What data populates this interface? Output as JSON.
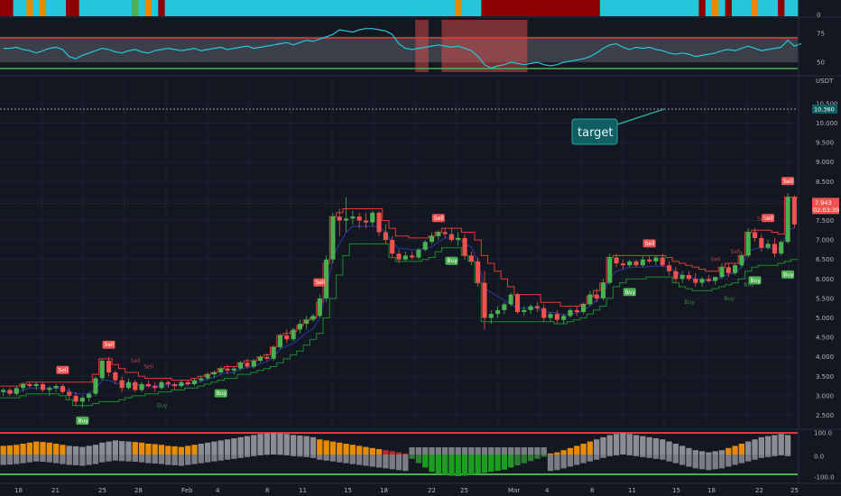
{
  "chart_data": {
    "type": "candlestick",
    "symbol_unit": "USDT",
    "colors": {
      "background": "#131722",
      "up": "#26a69a",
      "up_bright": "#4caf50",
      "down": "#ef5350",
      "cyan": "#26c6da",
      "dark_red": "#8b0000",
      "orange": "#e68a00",
      "band_fill": "#5d606b",
      "trail_red": "#e53935",
      "trail_green": "#1b8a2f",
      "ma_blue": "#283593"
    },
    "x_axis": {
      "labels": [
        "18",
        "21",
        "25",
        "28",
        "Feb",
        "4",
        "8",
        "11",
        "15",
        "18",
        "22",
        "25",
        "Mar",
        "4",
        "8",
        "11",
        "15",
        "18",
        "22",
        "25"
      ]
    },
    "price_axis": {
      "ticks": [
        "10.500",
        "10.000",
        "9.500",
        "9.000",
        "8.500",
        "8.000",
        "7.500",
        "7.000",
        "6.500",
        "6.000",
        "5.500",
        "5.000",
        "4.500",
        "4.000",
        "3.500",
        "3.000",
        "2.500"
      ],
      "target_level_label": "10.360",
      "last_price_label": "7.943",
      "countdown_label": "02:03:39"
    },
    "callout": {
      "text": "target"
    },
    "signal_labels": {
      "buy": "Buy",
      "sell": "Sell"
    },
    "candles": [
      [
        3.1,
        3.2,
        3.0,
        3.15
      ],
      [
        3.15,
        3.2,
        3.0,
        3.05
      ],
      [
        3.05,
        3.25,
        3.0,
        3.2
      ],
      [
        3.2,
        3.35,
        3.1,
        3.3
      ],
      [
        3.3,
        3.35,
        3.2,
        3.25
      ],
      [
        3.25,
        3.35,
        3.15,
        3.3
      ],
      [
        3.3,
        3.35,
        3.1,
        3.15
      ],
      [
        3.15,
        3.25,
        3.0,
        3.2
      ],
      [
        3.2,
        3.3,
        3.1,
        3.25
      ],
      [
        3.25,
        3.3,
        3.05,
        3.1
      ],
      [
        3.1,
        3.2,
        2.9,
        3.0
      ],
      [
        3.0,
        3.1,
        2.75,
        2.85
      ],
      [
        2.85,
        3.0,
        2.7,
        2.95
      ],
      [
        2.95,
        3.1,
        2.85,
        3.05
      ],
      [
        3.05,
        3.5,
        3.0,
        3.45
      ],
      [
        3.45,
        3.95,
        3.4,
        3.9
      ],
      [
        3.9,
        4.0,
        3.5,
        3.6
      ],
      [
        3.6,
        3.65,
        3.3,
        3.4
      ],
      [
        3.4,
        3.5,
        3.1,
        3.2
      ],
      [
        3.2,
        3.45,
        3.15,
        3.35
      ],
      [
        3.35,
        3.4,
        3.1,
        3.15
      ],
      [
        3.15,
        3.35,
        3.1,
        3.3
      ],
      [
        3.3,
        3.4,
        3.2,
        3.25
      ],
      [
        3.25,
        3.35,
        3.1,
        3.2
      ],
      [
        3.2,
        3.4,
        3.15,
        3.35
      ],
      [
        3.35,
        3.4,
        3.2,
        3.3
      ],
      [
        3.3,
        3.35,
        3.15,
        3.25
      ],
      [
        3.25,
        3.4,
        3.2,
        3.35
      ],
      [
        3.35,
        3.4,
        3.25,
        3.3
      ],
      [
        3.3,
        3.45,
        3.25,
        3.4
      ],
      [
        3.4,
        3.5,
        3.35,
        3.45
      ],
      [
        3.45,
        3.6,
        3.4,
        3.55
      ],
      [
        3.55,
        3.65,
        3.45,
        3.6
      ],
      [
        3.6,
        3.75,
        3.55,
        3.7
      ],
      [
        3.7,
        3.8,
        3.55,
        3.65
      ],
      [
        3.65,
        3.75,
        3.55,
        3.7
      ],
      [
        3.7,
        3.9,
        3.65,
        3.85
      ],
      [
        3.85,
        3.95,
        3.7,
        3.75
      ],
      [
        3.75,
        3.95,
        3.7,
        3.9
      ],
      [
        3.9,
        4.05,
        3.85,
        4.0
      ],
      [
        4.0,
        4.1,
        3.9,
        3.95
      ],
      [
        3.95,
        4.3,
        3.9,
        4.25
      ],
      [
        4.25,
        4.6,
        4.2,
        4.55
      ],
      [
        4.55,
        4.7,
        4.35,
        4.45
      ],
      [
        4.45,
        4.75,
        4.4,
        4.7
      ],
      [
        4.7,
        4.95,
        4.6,
        4.85
      ],
      [
        4.85,
        5.05,
        4.7,
        4.95
      ],
      [
        4.95,
        5.1,
        4.9,
        5.05
      ],
      [
        5.05,
        5.6,
        5.0,
        5.5
      ],
      [
        5.5,
        6.6,
        5.4,
        6.5
      ],
      [
        6.5,
        7.7,
        6.4,
        7.6
      ],
      [
        7.6,
        7.8,
        7.1,
        7.5
      ],
      [
        7.5,
        8.1,
        7.2,
        7.55
      ],
      [
        7.55,
        7.75,
        7.4,
        7.6
      ],
      [
        7.6,
        7.7,
        7.3,
        7.5
      ],
      [
        7.5,
        7.7,
        7.3,
        7.45
      ],
      [
        7.45,
        7.75,
        7.35,
        7.7
      ],
      [
        7.7,
        7.75,
        7.1,
        7.2
      ],
      [
        7.2,
        7.4,
        6.9,
        7.0
      ],
      [
        7.0,
        7.1,
        6.55,
        6.65
      ],
      [
        6.65,
        6.75,
        6.4,
        6.5
      ],
      [
        6.5,
        6.7,
        6.45,
        6.6
      ],
      [
        6.6,
        6.7,
        6.5,
        6.55
      ],
      [
        6.55,
        6.8,
        6.5,
        6.75
      ],
      [
        6.75,
        7.0,
        6.7,
        6.95
      ],
      [
        6.95,
        7.2,
        6.9,
        7.1
      ],
      [
        7.1,
        7.25,
        7.0,
        7.2
      ],
      [
        7.2,
        7.3,
        7.05,
        7.15
      ],
      [
        7.15,
        7.3,
        6.95,
        7.0
      ],
      [
        7.0,
        7.2,
        6.85,
        7.05
      ],
      [
        7.05,
        7.15,
        6.5,
        6.6
      ],
      [
        6.6,
        6.7,
        6.35,
        6.45
      ],
      [
        6.45,
        6.55,
        5.8,
        5.9
      ],
      [
        5.9,
        6.2,
        4.7,
        5.0
      ],
      [
        5.0,
        5.2,
        4.85,
        5.1
      ],
      [
        5.1,
        5.3,
        5.0,
        5.2
      ],
      [
        5.2,
        5.4,
        5.1,
        5.35
      ],
      [
        5.35,
        5.65,
        5.3,
        5.6
      ],
      [
        5.6,
        5.65,
        5.1,
        5.15
      ],
      [
        5.15,
        5.3,
        5.05,
        5.2
      ],
      [
        5.2,
        5.35,
        5.1,
        5.3
      ],
      [
        5.3,
        5.4,
        5.15,
        5.25
      ],
      [
        5.25,
        5.35,
        4.9,
        5.0
      ],
      [
        5.0,
        5.15,
        4.9,
        5.1
      ],
      [
        5.1,
        5.2,
        4.85,
        4.95
      ],
      [
        4.95,
        5.1,
        4.85,
        5.05
      ],
      [
        5.05,
        5.25,
        5.0,
        5.2
      ],
      [
        5.2,
        5.3,
        5.05,
        5.15
      ],
      [
        5.15,
        5.4,
        5.1,
        5.35
      ],
      [
        5.35,
        5.7,
        5.3,
        5.6
      ],
      [
        5.6,
        5.75,
        5.4,
        5.5
      ],
      [
        5.5,
        6.0,
        5.45,
        5.9
      ],
      [
        5.9,
        6.65,
        5.85,
        6.55
      ],
      [
        6.55,
        6.65,
        6.3,
        6.4
      ],
      [
        6.4,
        6.5,
        6.25,
        6.35
      ],
      [
        6.35,
        6.5,
        6.3,
        6.45
      ],
      [
        6.45,
        6.5,
        6.3,
        6.35
      ],
      [
        6.35,
        6.6,
        6.3,
        6.5
      ],
      [
        6.5,
        6.6,
        6.4,
        6.45
      ],
      [
        6.45,
        6.6,
        6.35,
        6.55
      ],
      [
        6.55,
        6.65,
        6.3,
        6.35
      ],
      [
        6.35,
        6.45,
        6.1,
        6.2
      ],
      [
        6.2,
        6.3,
        5.9,
        6.0
      ],
      [
        6.0,
        6.2,
        5.9,
        6.1
      ],
      [
        6.1,
        6.2,
        5.95,
        6.0
      ],
      [
        6.0,
        6.15,
        5.8,
        5.9
      ],
      [
        5.9,
        6.05,
        5.8,
        6.0
      ],
      [
        6.0,
        6.1,
        5.9,
        5.95
      ],
      [
        5.95,
        6.05,
        5.85,
        6.05
      ],
      [
        6.05,
        6.4,
        6.0,
        6.3
      ],
      [
        6.3,
        6.4,
        6.05,
        6.15
      ],
      [
        6.15,
        6.4,
        6.1,
        6.35
      ],
      [
        6.35,
        6.7,
        6.3,
        6.6
      ],
      [
        6.6,
        7.3,
        6.55,
        7.2
      ],
      [
        7.2,
        7.3,
        6.95,
        7.05
      ],
      [
        7.05,
        7.15,
        6.7,
        6.8
      ],
      [
        6.8,
        7.0,
        6.75,
        6.9
      ],
      [
        6.9,
        7.05,
        6.55,
        6.65
      ],
      [
        6.65,
        7.0,
        6.6,
        6.95
      ],
      [
        6.95,
        8.2,
        6.9,
        8.1
      ],
      [
        8.1,
        8.15,
        7.3,
        7.4
      ]
    ],
    "trail_red": [
      3.25,
      3.25,
      3.25,
      3.3,
      3.35,
      3.35,
      3.35,
      3.35,
      3.35,
      3.35,
      3.35,
      3.35,
      3.35,
      3.35,
      3.55,
      3.95,
      3.95,
      3.8,
      3.7,
      3.6,
      3.6,
      3.5,
      3.45,
      3.45,
      3.45,
      3.45,
      3.4,
      3.4,
      3.4,
      3.45,
      3.5,
      3.55,
      3.6,
      3.7,
      3.75,
      3.75,
      3.85,
      3.9,
      3.9,
      4.0,
      4.05,
      4.25,
      4.55,
      4.6,
      4.65,
      4.8,
      4.95,
      5.0,
      5.4,
      6.4,
      7.6,
      7.7,
      7.8,
      7.8,
      7.8,
      7.8,
      7.8,
      7.8,
      7.5,
      7.3,
      7.1,
      7.1,
      7.05,
      7.05,
      7.05,
      7.1,
      7.2,
      7.3,
      7.3,
      7.3,
      7.2,
      7.2,
      7.0,
      6.6,
      6.4,
      6.2,
      6.0,
      5.8,
      5.6,
      5.6,
      5.6,
      5.6,
      5.4,
      5.4,
      5.4,
      5.3,
      5.3,
      5.3,
      5.35,
      5.55,
      5.7,
      5.9,
      6.55,
      6.6,
      6.6,
      6.6,
      6.6,
      6.6,
      6.6,
      6.6,
      6.6,
      6.55,
      6.45,
      6.4,
      6.35,
      6.3,
      6.25,
      6.2,
      6.2,
      6.3,
      6.4,
      6.4,
      6.6,
      7.2,
      7.25,
      7.25,
      7.25,
      7.2,
      7.15,
      8.1,
      8.1
    ],
    "trail_green": [
      2.95,
      2.95,
      2.95,
      3.0,
      3.05,
      3.05,
      3.05,
      3.05,
      3.05,
      3.0,
      2.9,
      2.75,
      2.75,
      2.75,
      2.8,
      2.85,
      2.85,
      2.85,
      2.9,
      2.95,
      3.0,
      3.0,
      3.05,
      3.05,
      3.1,
      3.1,
      3.15,
      3.15,
      3.2,
      3.2,
      3.25,
      3.3,
      3.35,
      3.4,
      3.45,
      3.45,
      3.55,
      3.55,
      3.6,
      3.65,
      3.7,
      3.75,
      3.85,
      3.95,
      4.05,
      4.15,
      4.3,
      4.45,
      4.6,
      5.0,
      5.5,
      6.1,
      6.6,
      6.9,
      6.9,
      6.9,
      6.9,
      6.9,
      6.9,
      6.55,
      6.45,
      6.45,
      6.45,
      6.45,
      6.5,
      6.55,
      6.7,
      6.8,
      6.8,
      6.8,
      6.6,
      6.45,
      5.9,
      4.9,
      4.9,
      4.9,
      4.9,
      4.9,
      4.9,
      4.9,
      4.9,
      4.9,
      4.9,
      4.9,
      4.85,
      4.85,
      4.9,
      4.95,
      5.0,
      5.1,
      5.2,
      5.3,
      5.5,
      5.8,
      5.9,
      6.0,
      6.0,
      6.0,
      6.05,
      6.05,
      6.05,
      6.05,
      5.9,
      5.8,
      5.75,
      5.7,
      5.7,
      5.7,
      5.75,
      5.8,
      5.85,
      5.9,
      6.0,
      6.2,
      6.3,
      6.35,
      6.35,
      6.35,
      6.4,
      6.45,
      6.5
    ],
    "buy_indices": [
      12,
      33,
      68,
      95,
      114,
      119
    ],
    "sell_indices": [
      9,
      16,
      48,
      66,
      98,
      116,
      119
    ],
    "faint_buy_indices": [
      24,
      104,
      110,
      113
    ],
    "faint_sell_indices": [
      20,
      22,
      108,
      111,
      115
    ],
    "heat_colors": [
      "darkred",
      "darkred",
      "cyan",
      "cyan",
      "orange",
      "cyan",
      "orange",
      "cyan",
      "cyan",
      "cyan",
      "darkred",
      "darkred",
      "cyan",
      "cyan",
      "cyan",
      "cyan",
      "cyan",
      "cyan",
      "cyan",
      "cyan",
      "green",
      "cyan",
      "orange",
      "cyan",
      "darkred",
      "cyan",
      "cyan",
      "cyan",
      "cyan",
      "cyan",
      "cyan",
      "cyan",
      "cyan",
      "cyan",
      "cyan",
      "cyan",
      "cyan",
      "cyan",
      "cyan",
      "cyan",
      "cyan",
      "cyan",
      "cyan",
      "cyan",
      "cyan",
      "cyan",
      "cyan",
      "cyan",
      "cyan",
      "cyan",
      "cyan",
      "cyan",
      "cyan",
      "cyan",
      "cyan",
      "cyan",
      "cyan",
      "cyan",
      "cyan",
      "cyan",
      "cyan",
      "cyan",
      "cyan",
      "cyan",
      "cyan",
      "cyan",
      "cyan",
      "cyan",
      "cyan",
      "orange",
      "cyan",
      "cyan",
      "cyan",
      "darkred",
      "darkred",
      "darkred",
      "darkred",
      "darkred",
      "darkred",
      "darkred",
      "darkred",
      "darkred",
      "darkred",
      "darkred",
      "darkred",
      "darkred",
      "darkred",
      "darkred",
      "darkred",
      "darkred",
      "darkred",
      "cyan",
      "cyan",
      "cyan",
      "cyan",
      "cyan",
      "cyan",
      "cyan",
      "cyan",
      "cyan",
      "cyan",
      "cyan",
      "cyan",
      "cyan",
      "cyan",
      "cyan",
      "darkred",
      "cyan",
      "orange",
      "cyan",
      "darkred",
      "cyan",
      "cyan",
      "cyan",
      "orange",
      "cyan",
      "cyan",
      "cyan",
      "darkred",
      "cyan",
      "cyan"
    ],
    "osc_axis": {
      "ticks": [
        "75",
        "50"
      ]
    },
    "osc_line": [
      62,
      62,
      63,
      61,
      60,
      58,
      60,
      62,
      63,
      61,
      55,
      53,
      56,
      58,
      60,
      62,
      61,
      59,
      58,
      60,
      61,
      59,
      58,
      60,
      61,
      62,
      61,
      60,
      61,
      62,
      60,
      61,
      62,
      63,
      61,
      62,
      63,
      64,
      62,
      63,
      64,
      65,
      66,
      67,
      65,
      67,
      69,
      68,
      70,
      72,
      74,
      78,
      77,
      76,
      78,
      79,
      79,
      78,
      77,
      74,
      66,
      62,
      61,
      62,
      63,
      64,
      65,
      64,
      63,
      64,
      62,
      60,
      55,
      48,
      45,
      47,
      48,
      50,
      49,
      48,
      49,
      50,
      48,
      47,
      48,
      50,
      51,
      52,
      53,
      55,
      58,
      62,
      65,
      66,
      63,
      61,
      63,
      62,
      63,
      61,
      60,
      58,
      57,
      58,
      57,
      55,
      56,
      57,
      58,
      60,
      61,
      60,
      62,
      64,
      62,
      60,
      61,
      62,
      63,
      69,
      64,
      66
    ],
    "osc_band": [
      50,
      72
    ],
    "osc_highlights": [
      [
        63,
        64
      ],
      [
        67,
        79
      ]
    ],
    "bottom_axis": {
      "ticks": [
        "100.0",
        "0.0",
        "-100.0"
      ]
    },
    "bottom_bars": [
      40,
      42,
      45,
      50,
      55,
      60,
      58,
      55,
      50,
      45,
      40,
      38,
      35,
      40,
      45,
      55,
      60,
      65,
      62,
      60,
      58,
      55,
      50,
      48,
      45,
      40,
      38,
      35,
      40,
      45,
      50,
      55,
      60,
      65,
      70,
      75,
      80,
      85,
      90,
      95,
      98,
      100,
      98,
      95,
      90,
      88,
      85,
      80,
      70,
      65,
      60,
      55,
      50,
      45,
      40,
      35,
      30,
      25,
      20,
      15,
      10,
      5,
      -20,
      -40,
      -60,
      -80,
      -90,
      -95,
      -98,
      -100,
      -98,
      -95,
      -90,
      -85,
      -80,
      -75,
      -70,
      -60,
      -50,
      -40,
      -30,
      -20,
      -10,
      5,
      10,
      20,
      30,
      40,
      50,
      60,
      70,
      80,
      90,
      95,
      100,
      95,
      90,
      85,
      80,
      75,
      70,
      60,
      50,
      40,
      30,
      20,
      15,
      10,
      15,
      20,
      30,
      40,
      50,
      60,
      70,
      80,
      85,
      90,
      95,
      90
    ],
    "bottom_top_color": [
      "orange",
      "orange",
      "orange",
      "orange",
      "orange",
      "orange",
      "orange",
      "orange",
      "orange",
      "orange",
      "gray",
      "gray",
      "gray",
      "gray",
      "gray",
      "gray",
      "gray",
      "gray",
      "gray",
      "gray",
      "orange",
      "orange",
      "orange",
      "orange",
      "orange",
      "orange",
      "orange",
      "orange",
      "orange",
      "orange",
      "gray",
      "gray",
      "gray",
      "gray",
      "gray",
      "gray",
      "gray",
      "gray",
      "gray",
      "gray",
      "gray",
      "gray",
      "gray",
      "gray",
      "gray",
      "gray",
      "gray",
      "gray",
      "orange",
      "orange",
      "orange",
      "orange",
      "orange",
      "orange",
      "orange",
      "orange",
      "orange",
      "orange",
      "red",
      "red",
      "red",
      "red",
      "red",
      "red",
      "red",
      "red",
      "red",
      "red",
      "red",
      "red",
      "red",
      "red",
      "red",
      "red",
      "red",
      "red",
      "red",
      "red",
      "red",
      "red",
      "orange",
      "orange",
      "orange",
      "orange",
      "orange",
      "orange",
      "orange",
      "orange",
      "orange",
      "orange",
      "gray",
      "gray",
      "gray",
      "gray",
      "gray",
      "gray",
      "gray",
      "gray",
      "gray",
      "gray",
      "gray",
      "gray",
      "gray",
      "gray",
      "gray",
      "gray",
      "gray",
      "gray",
      "gray",
      "gray",
      "orange",
      "orange",
      "orange",
      "gray",
      "gray",
      "gray",
      "gray",
      "gray",
      "gray",
      "gray",
      "gray",
      "orange",
      "orange",
      "orange",
      "orange",
      "orange",
      "orange",
      "orange"
    ]
  }
}
